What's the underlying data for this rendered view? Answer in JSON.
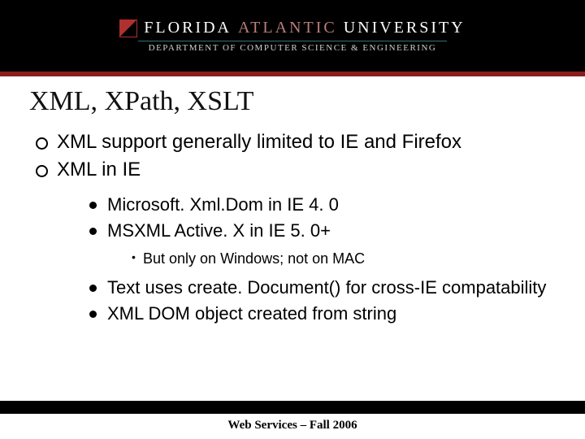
{
  "header": {
    "logo_florida": "FLORIDA",
    "logo_atlantic": "ATLANTIC",
    "logo_university": "UNIVERSITY",
    "dept_line": "DEPARTMENT OF COMPUTER SCIENCE & ENGINEERING"
  },
  "slide": {
    "title": "XML, XPath, XSLT",
    "bullets_l1": [
      "XML support generally limited to IE and Firefox",
      "XML in IE"
    ],
    "bullets_l2a": [
      "Microsoft. Xml.Dom in IE 4. 0",
      "MSXML Active. X in IE 5. 0+"
    ],
    "bullets_l3": [
      "But only on Windows; not on MAC"
    ],
    "bullets_l2b": [
      "Text uses create. Document() for cross-IE compatability",
      "XML DOM object created from string"
    ]
  },
  "footer": {
    "text": "Web Services – Fall 2006"
  },
  "colors": {
    "header_bg": "#000000",
    "accent_red": "#8a1e1e"
  }
}
